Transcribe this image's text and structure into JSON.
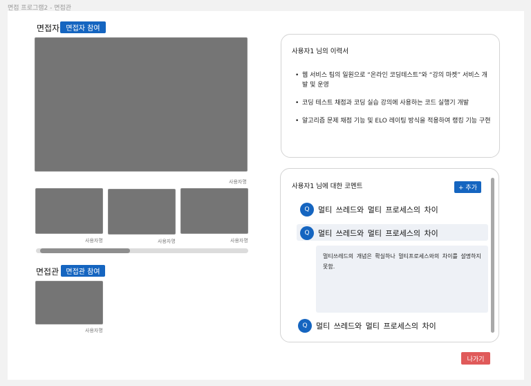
{
  "window": {
    "title": "면접 프로그램2 - 면접관"
  },
  "interviewee_section": {
    "label": "면접자",
    "join_button": "면접자 참여",
    "main_video_caption": "사용자명",
    "thumbnails": [
      {
        "caption": "사용자명"
      },
      {
        "caption": "사용자명"
      },
      {
        "caption": "사용자명"
      }
    ]
  },
  "interviewer_section": {
    "label": "면접관",
    "join_button": "면접관 참여",
    "video_caption": "사용자명"
  },
  "resume_card": {
    "title": "사용자1 님의 이력서",
    "items": [
      "웹 서비스 팀의 일원으로 “온라인 코딩테스트”와 “강의 마켓” 서비스 개발 및 운영",
      "코딩 테스트 채점과 코딩 실습 강의에 사용하는 코드 실행기 개발",
      "알고리즘 문제 채점 기능 및 ELO 레이팅 방식을 적용하여 랭킹 기능 구현"
    ]
  },
  "comment_card": {
    "title": "사용자1 님에 대한 코멘트",
    "add_button": "+ 추가",
    "questions": [
      {
        "badge": "Q",
        "text": "멀티 쓰레드와 멀티 프로세스의 차이"
      },
      {
        "badge": "Q",
        "text": "멀티 쓰레드와 멀티 프로세스의 차이"
      },
      {
        "badge": "Q",
        "text": "멀티 쓰레드와 멀티 프로세스의 차이"
      }
    ],
    "answer": "멀티쓰레드의 개념은 확실하나 멀티프로세스와의 차이를 설명하지 못함."
  },
  "footer": {
    "exit_button": "나가기"
  },
  "colors": {
    "primary": "#1565c0",
    "danger": "#e05a5a",
    "video_placeholder": "#757575"
  }
}
